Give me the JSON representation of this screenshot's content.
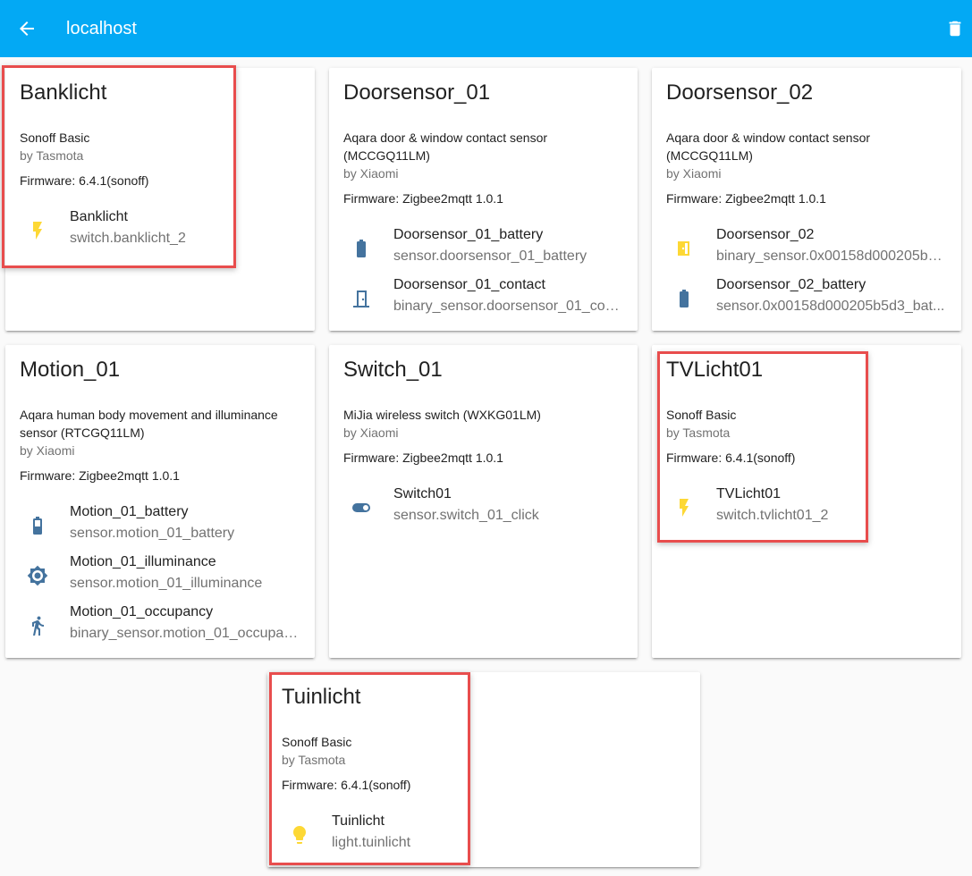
{
  "header": {
    "title": "localhost"
  },
  "colors": {
    "appbar": "#03a9f4",
    "icon_blue": "#44739e",
    "icon_yellow": "#fdd835",
    "highlight": "#e84d4d"
  },
  "cards": [
    {
      "title": "Banklicht",
      "model": "Sonoff Basic",
      "manufacturer": "by Tasmota",
      "firmware": "Firmware: 6.4.1(sonoff)",
      "entities": [
        {
          "name": "Banklicht",
          "entity_id": "switch.banklicht_2",
          "icon": "flash-icon"
        }
      ]
    },
    {
      "title": "Doorsensor_01",
      "model": "Aqara door & window contact sensor (MCCGQ11LM)",
      "manufacturer": "by Xiaomi",
      "firmware": "Firmware: Zigbee2mqtt 1.0.1",
      "entities": [
        {
          "name": "Doorsensor_01_battery",
          "entity_id": "sensor.doorsensor_01_battery",
          "icon": "battery-icon"
        },
        {
          "name": "Doorsensor_01_contact",
          "entity_id": "binary_sensor.doorsensor_01_con...",
          "icon": "door-closed-icon"
        }
      ]
    },
    {
      "title": "Doorsensor_02",
      "model": "Aqara door & window contact sensor (MCCGQ11LM)",
      "manufacturer": "by Xiaomi",
      "firmware": "Firmware: Zigbee2mqtt 1.0.1",
      "entities": [
        {
          "name": "Doorsensor_02",
          "entity_id": "binary_sensor.0x00158d000205b5...",
          "icon": "door-open-icon"
        },
        {
          "name": "Doorsensor_02_battery",
          "entity_id": "sensor.0x00158d000205b5d3_bat...",
          "icon": "battery-icon"
        }
      ]
    },
    {
      "title": "Motion_01",
      "model": "Aqara human body movement and illuminance sensor (RTCGQ11LM)",
      "manufacturer": "by Xiaomi",
      "firmware": "Firmware: Zigbee2mqtt 1.0.1",
      "entities": [
        {
          "name": "Motion_01_battery",
          "entity_id": "sensor.motion_01_battery",
          "icon": "battery-icon"
        },
        {
          "name": "Motion_01_illuminance",
          "entity_id": "sensor.motion_01_illuminance",
          "icon": "brightness-icon"
        },
        {
          "name": "Motion_01_occupancy",
          "entity_id": "binary_sensor.motion_01_occupan...",
          "icon": "walk-icon"
        }
      ]
    },
    {
      "title": "Switch_01",
      "model": "MiJia wireless switch (WXKG01LM)",
      "manufacturer": "by Xiaomi",
      "firmware": "Firmware: Zigbee2mqtt 1.0.1",
      "entities": [
        {
          "name": "Switch01",
          "entity_id": "sensor.switch_01_click",
          "icon": "toggle-switch-icon"
        }
      ]
    },
    {
      "title": "TVLicht01",
      "model": "Sonoff Basic",
      "manufacturer": "by Tasmota",
      "firmware": "Firmware: 6.4.1(sonoff)",
      "entities": [
        {
          "name": "TVLicht01",
          "entity_id": "switch.tvlicht01_2",
          "icon": "flash-icon"
        }
      ]
    },
    {
      "title": "Tuinlicht",
      "model": "Sonoff Basic",
      "manufacturer": "by Tasmota",
      "firmware": "Firmware: 6.4.1(sonoff)",
      "entities": [
        {
          "name": "Tuinlicht",
          "entity_id": "light.tuinlicht",
          "icon": "lightbulb-icon"
        }
      ]
    }
  ]
}
